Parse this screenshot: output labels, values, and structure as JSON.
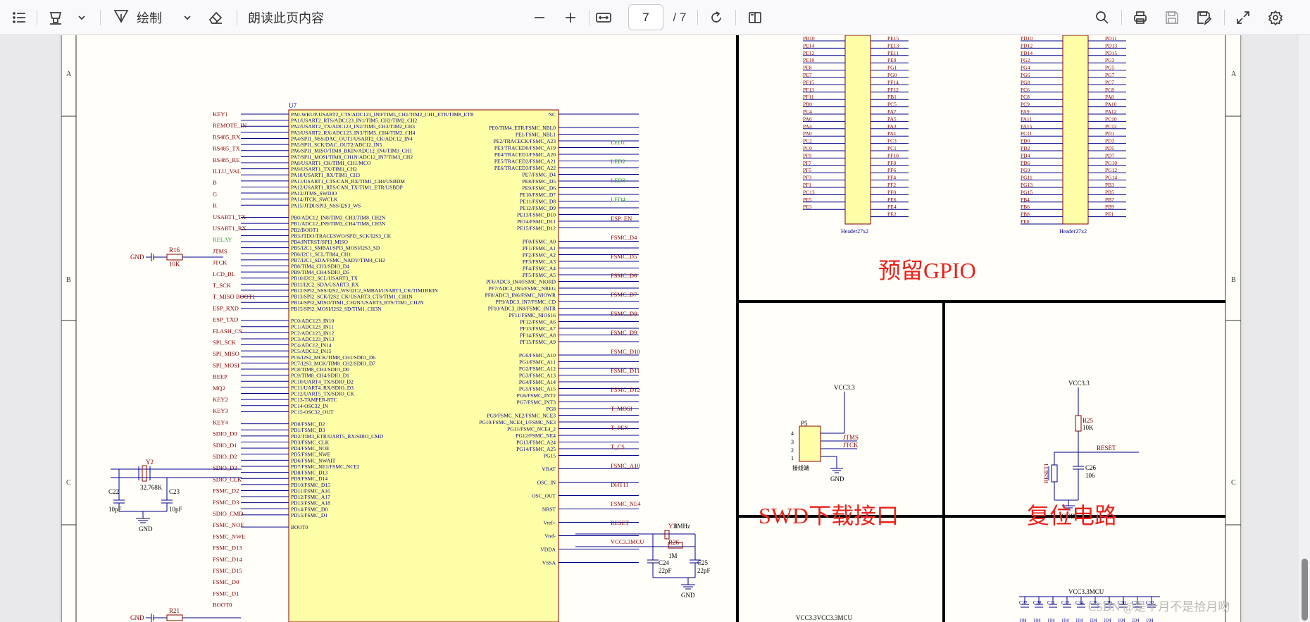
{
  "toolbar": {
    "draw_label": "绘制",
    "read_aloud_label": "朗读此页内容",
    "current_page": "7",
    "page_total": "/ 7",
    "icons": [
      "list-icon",
      "highlighter-icon",
      "chevron-down-icon",
      "draw-pen-icon",
      "chevron-down-icon",
      "eraser-icon",
      "zoom-out-icon",
      "zoom-in-icon",
      "fit-width-icon",
      "rotate-icon",
      "page-view-icon",
      "search-icon",
      "print-icon",
      "save-icon",
      "save-as-icon",
      "fullscreen-icon",
      "settings-icon"
    ]
  },
  "schematic": {
    "frame_rows": [
      "A",
      "B",
      "C"
    ],
    "mcu": {
      "ref": "U7",
      "left_pin_labels": [
        "PA0-WKUP/USART2_CTS/ADC123_IN0/TIM5_CH1/TIM2_CH1_ETR/TIM8_ETR",
        "PA1/USART2_RTS/ADC123_IN1/TIM5_CH2/TIM2_CH2",
        "PA2/USART2_TX/ADC123_IN2/TIM5_CH3/TIM2_CH3",
        "PA3/USART2_RX/ADC123_IN3/TIM5_CH4/TIM2_CH4",
        "PA4/SPI1_NSS/DAC_OUT1/USART2_CK/ADC12_IN4",
        "PA5/SPI1_SCK/DAC_OUT2/ADC12_IN5",
        "PA6/SPI1_MISO/TIM8_BKIN/ADC12_IN6/TIM3_CH1",
        "PA7/SPI1_MOSI/TIM8_CH1N/ADC12_IN7/TIM3_CH2",
        "PA8/USART1_CK/TIM1_CH1/MCO",
        "PA9/USART1_TX/TIM1_CH2",
        "PA10/USART1_RX/TIM1_CH3",
        "PA11/USART1_CTS/CAN_RX/TIM1_CH4/USBDM",
        "PA12/USART1_RTS/CAN_TX/TIM1_ETR/USBDP",
        "PA13/JTMS_SWDIO",
        "PA14/JTCK_SWCLK",
        "PA15/JTDI/SPI3_NSS/I2S3_WS",
        "",
        "PB0/ADC12_IN8/TIM3_CH3/TIM8_CH2N",
        "PB1/ADC12_IN9/TIM3_CH4/TIM8_CH3N",
        "PB2/BOOT1",
        "PB3/JTDO/TRACESWO/SPI3_SCK/I2S3_CK",
        "PB4/JNTRST/SPI3_MISO",
        "PB5/I2C1_SMBAI/SPI3_MOSI/I2S3_SD",
        "PB6/I2C1_SCL/TIM4_CH1",
        "PB7/I2C1_SDA/FSMC_NADV/TIM4_CH2",
        "PB8/TIM4_CH3/SDIO_D4",
        "PB9/TIM4_CH4/SDIO_D5",
        "PB10/I2C2_SCL/USART3_TX",
        "PB11/I2C2_SDA/USART3_RX",
        "PB12/SPI2_NSS/I2S2_WS/I2C2_SMBAI/USART3_CK/TIM1BKIN",
        "PB13/SPI2_SCK/I2S2_CK/USART3_CTS/TIM1_CH1N",
        "PB14/SPI2_MISO/TIM1_CH2N/USART3_RTS/TIM1_CH2N",
        "PB15/SPI2_MOSI/I2S2_SD/TIM1_CH3N",
        "",
        "PC0/ADC123_IN10",
        "PC1/ADC123_IN11",
        "PC2/ADC123_IN12",
        "PC3/ADC123_IN13",
        "PC4/ADC12_IN14",
        "PC5/ADC12_IN15",
        "PC6/I2S2_MCK/TIM8_CH1/SDIO_D6",
        "PC7/I2S3_MCK/TIM8_CH2/SDIO_D7",
        "PC8/TIM8_CH3/SDIO_D0",
        "PC9/TIM8_CH4/SDIO_D1",
        "PC10/UART4_TX/SDIO_D2",
        "PC11/UART4_RX/SDIO_D3",
        "PC12/UART5_TX/SDIO_CK",
        "PC13-TAMPER-RTC",
        "PC14-OSC32_IN",
        "PC15-OSC32_OUT",
        "",
        "PD0/FSMC_D2",
        "PD1/FSMC_D3",
        "PD2/TIM3_ETR/UART5_RX/SDIO_CMD",
        "PD3/FSMC_CLK",
        "PD4/FSMC_NOE",
        "PD5/FSMC_NWE",
        "PD6/FSMC_NWAIT",
        "PD7/FSMC_NE1/FSMC_NCE2",
        "PD8/FSMC_D13",
        "PD9/FSMC_D14",
        "PD10/FSMC_D15",
        "PD11/FSMC_A16",
        "PD12/FSMC_A17",
        "PD13/FSMC_A18",
        "PD14/FSMC_D0",
        "PD15/FSMC_D1",
        "",
        "BOOT0"
      ],
      "right_pin_labels": [
        "NC",
        "",
        "PE0/TIM4_ETR/FSMC_NBL0",
        "PE1/FSMC_NBL1",
        "PE2/TRACECK/FSMC_A23",
        "PE3/TRACED0/FSMC_A19",
        "PE4/TRACED1/FSMC_A20",
        "PE5/TRACED2/FSMC_A21",
        "PE6/TRACED3/FSMC_A22",
        "PE7/FSMC_D4",
        "PE8/FSMC_D5",
        "PE9/FSMC_D6",
        "PE10/FSMC_D7",
        "PE11/FSMC_D8",
        "PE12/FSMC_D9",
        "PE13/FSMC_D10",
        "PE14/FSMC_D11",
        "PE15/FSMC_D12",
        "",
        "PF0/FSMC_A0",
        "PF1/FSMC_A1",
        "PF2/FSMC_A2",
        "PF3/FSMC_A3",
        "PF4/FSMC_A4",
        "PF5/FSMC_A5",
        "PF6/ADC3_IN4/FSMC_NIORD",
        "PF7/ADC3_IN5/FSMC_NREG",
        "PF8/ADC3_IN6/FSMC_NIOWR",
        "PF9/ADC3_IN7/FSMC_CD",
        "PF10/ADC3_IN8/FSMC_INTR",
        "PF11/FSMC_NIOS16",
        "PF12/FSMC_A6",
        "PF13/FSMC_A7",
        "PF14/FSMC_A8",
        "PF15/FSMC_A9",
        "",
        "PG0/FSMC_A10",
        "PG1/FSMC_A11",
        "PG2/FSMC_A12",
        "PG3/FSMC_A13",
        "PG4/FSMC_A14",
        "PG5/FSMC_A15",
        "PG6/FSMC_INT2",
        "PG7/FSMC_INT3",
        "PG8",
        "PG9/FSMC_NE2/FSMC_NCE3",
        "PG10/FSMC_NCE4_1/FSMC_NE3",
        "PG11/FSMC_NCE4_2",
        "PG12/FSMC_NE4",
        "PG13/FSMC_A24",
        "PG14/FSMC_A25",
        "PG15",
        "",
        "VBAT",
        "",
        "OSC_IN",
        "",
        "OSC_OUT",
        "",
        "NRST",
        "",
        "Vref+",
        "",
        "Vref-",
        "",
        "VDDA",
        "",
        "VSSA"
      ],
      "net_labels_left": [
        "KEY1",
        "REMOTE_IN",
        "RS485_RX",
        "RS485_TX",
        "RS485_RE",
        "ILLU_VAL",
        "B",
        "G",
        "R",
        "USART1_TX",
        "USART1_RX",
        "RELAY",
        "JTMS",
        "JTCK",
        "LCD_BL",
        "T_SCK",
        "T_MISO BOOT1",
        "ESP_RXD",
        "ESP_TXD",
        "FLASH_CS",
        "SPI_SCK",
        "SPI_MISO",
        "SPI_MOSI",
        "BEEP",
        "MQ2",
        "KEY2",
        "KEY3",
        "KEY4",
        "SDIO_D0",
        "SDIO_D1",
        "SDIO_D2",
        "SDIO_D3",
        "SDIO_CLK",
        "FSMC_D2",
        "FSMC_D3",
        "SDIO_CMD",
        "FSMC_NOE",
        "FSMC_NWE",
        "FSMC_D13",
        "FSMC_D14",
        "FSMC_D15",
        "FSMC_D0",
        "FSMC_D1",
        "BOOT0"
      ],
      "net_labels_right": [
        "LED1",
        "LED2",
        "LED3",
        "LED4",
        "ESP_EN",
        "FSMC_D4",
        "FSMC_D5",
        "FSMC_D6",
        "FSMC_D7",
        "FSMC_D8",
        "FSMC_D9",
        "FSMC_D10",
        "FSMC_D11",
        "FSMC_D12",
        "T_MOSI",
        "T_PEN",
        "T_CS",
        "FSMC_A10",
        "DHT11",
        "FSMC_NE4",
        "RESET",
        "VCC3.3MCU"
      ]
    },
    "parts": {
      "r16": "R16",
      "r16_val": "10K",
      "r21": "R21",
      "gnd": "GND",
      "y2": "Y2",
      "y2_val": "32.768K",
      "c22": "C22",
      "c23": "C23",
      "c22_val": "10pF",
      "c23_val": "10pF",
      "y3": "Y3",
      "y3_val": "8MHz",
      "r26": "R26",
      "r26_val": "1M",
      "c24": "C24",
      "c25": "C25",
      "c24_val": "22pF",
      "c25_val": "22pF"
    },
    "gpio_section": {
      "title": "预留GPIO",
      "header_a_name": "Header27x2",
      "header_b_name": "Header27x2",
      "header_a_left": [
        "PB10",
        "PE14",
        "PE12",
        "PE10",
        "PE8",
        "PE7",
        "PF15",
        "PF13",
        "PF11",
        "PB0",
        "PC4",
        "PA6",
        "PA4",
        "PA0",
        "PC2",
        "PC0",
        "PF9",
        "PF7",
        "PF5",
        "PF3",
        "PF1",
        "PC13",
        "PE5",
        "PE3"
      ],
      "header_a_right": [
        "PE15",
        "PE13",
        "PE11",
        "PE9",
        "PG1",
        "PG0",
        "PF14",
        "PF12",
        "PB1",
        "PC5",
        "PA7",
        "PA5",
        "PA3",
        "PA1",
        "PC3",
        "PC1",
        "PF10",
        "PF8",
        "PF6",
        "PF4",
        "PF2",
        "PF0",
        "PE6",
        "PE4",
        "PE2"
      ],
      "header_b_left": [
        "PD10",
        "PD12",
        "PD14",
        "PG2",
        "PG4",
        "PG6",
        "PG8",
        "PC6",
        "PC8",
        "PC9",
        "PA9",
        "PA11",
        "PA15",
        "PC11",
        "PD0",
        "PD2",
        "PD4",
        "PD6",
        "PG9",
        "PG11",
        "PG13",
        "PG15",
        "PB4",
        "PB6",
        "PB8",
        "PE0"
      ],
      "header_b_right": [
        "PD11",
        "PD13",
        "PD15",
        "PG3",
        "PG5",
        "PG7",
        "PC7",
        "PC8",
        "PA8",
        "PA10",
        "PA12",
        "PC10",
        "PC12",
        "PD1",
        "PD3",
        "PD5",
        "PD7",
        "PG10",
        "PG12",
        "PG14",
        "PB3",
        "PB5",
        "PB7",
        "PB9",
        "PE1"
      ]
    },
    "swd_section": {
      "title": "SWD下载接口",
      "connector": "P5",
      "connector_caption": "接线端",
      "vcc": "VCC3.3",
      "jtms": "JTMS",
      "jtck": "JTCK",
      "gnd": "GND"
    },
    "reset_section": {
      "title": "复位电路",
      "vcc": "VCC3.3",
      "r25": "R25",
      "r25_val": "10K",
      "reset_net": "RESET",
      "switch": "RESET1",
      "c26": "C26",
      "c26_val": "106",
      "gnd": "GND"
    },
    "bottom": {
      "vcc_mcu": "VCC3.3MCU",
      "vcc_labels": "VCC3.3VCC3.3MCU",
      "cap_labels": [
        "C27",
        "C28",
        "C11",
        "C12",
        "C14",
        "C15",
        "C29",
        "C30",
        "C31",
        "C32"
      ],
      "cap_vals": [
        "104",
        "104",
        "104",
        "104",
        "104",
        "104",
        "104",
        "104",
        "104",
        "104"
      ]
    },
    "watermark": "CSDN @是十月不是拾月吻"
  }
}
